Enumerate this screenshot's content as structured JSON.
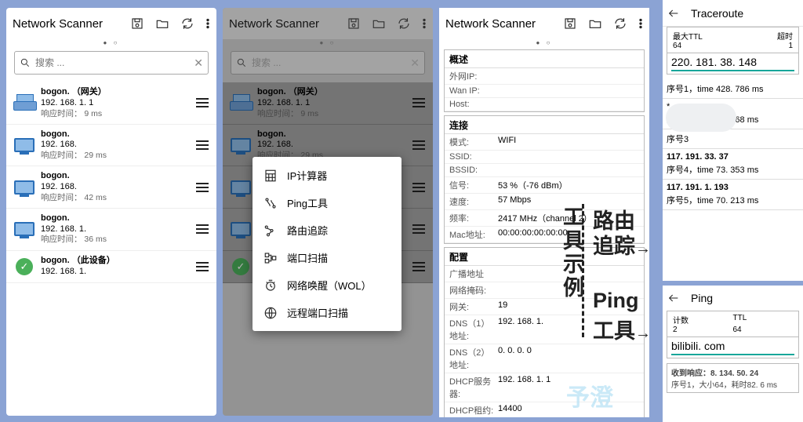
{
  "app_title": "Network Scanner",
  "page_dots": "●  ○",
  "search": {
    "placeholder": "搜索 ..."
  },
  "devices": [
    {
      "name": "bogon. （网关）",
      "ip": "192. 168. 1. 1",
      "rt": "响应时间： 9 ms",
      "icon": "scanner"
    },
    {
      "name": "bogon.",
      "ip": "192. 168.",
      "rt": "响应时间： 29 ms",
      "icon": "monitor"
    },
    {
      "name": "bogon.",
      "ip": "192. 168.",
      "rt": "响应时间： 42 ms",
      "icon": "monitor"
    },
    {
      "name": "bogon.",
      "ip": "192. 168. 1.",
      "rt": "响应时间： 36 ms",
      "icon": "monitor"
    },
    {
      "name": "bogon. （此设备）",
      "ip": "192. 168. 1.",
      "rt": "",
      "icon": "ok"
    }
  ],
  "popup": [
    {
      "icon": "calc",
      "label": "IP计算器"
    },
    {
      "icon": "ping",
      "label": "Ping工具"
    },
    {
      "icon": "trace",
      "label": "路由追踪"
    },
    {
      "icon": "port",
      "label": "端口扫描"
    },
    {
      "icon": "clock",
      "label": "网络唤醒（WOL）"
    },
    {
      "icon": "globe",
      "label": "远程端口扫描"
    }
  ],
  "details": {
    "sections": {
      "overview": {
        "title": "概述",
        "rows": [
          {
            "k": "外网IP:",
            "v": ""
          },
          {
            "k": "Wan IP:",
            "v": ""
          },
          {
            "k": "Host:",
            "v": ""
          }
        ]
      },
      "conn": {
        "title": "连接",
        "rows": [
          {
            "k": "模式:",
            "v": "WIFI"
          },
          {
            "k": "SSID:",
            "v": ""
          },
          {
            "k": "BSSID:",
            "v": ""
          },
          {
            "k": "信号:",
            "v": "53 %（-76 dBm）"
          },
          {
            "k": "速度:",
            "v": "57 Mbps"
          },
          {
            "k": "频率:",
            "v": "2417 MHz（channel 2）"
          },
          {
            "k": "Mac地址:",
            "v": "00:00:00:00:00:00"
          }
        ]
      },
      "config": {
        "title": "配置",
        "rows": [
          {
            "k": "广播地址",
            "v": ""
          },
          {
            "k": "网络掩码:",
            "v": ""
          },
          {
            "k": "网关:",
            "v": "19"
          },
          {
            "k": "DNS（1）地址:",
            "v": "192. 168. 1."
          },
          {
            "k": "DNS（2）地址:",
            "v": "0. 0. 0. 0"
          },
          {
            "k": "DHCP服务器:",
            "v": "192. 168. 1. 1"
          },
          {
            "k": "DHCP租约:",
            "v": "14400"
          }
        ]
      }
    }
  },
  "annot": {
    "col1": "工具示例",
    "label1": "路由",
    "label1b": "追踪",
    "label2": "Ping",
    "label2b": "工具",
    "arrow": "→"
  },
  "watermark": "予澄",
  "traceroute": {
    "title": "Traceroute",
    "maxttl_label": "最大TTL",
    "maxttl": "64",
    "timeout_label": "超时",
    "timeout": "1",
    "host": "220. 181. 38. 148",
    "hops": [
      {
        "seq": "序号1，time 428. 786 ms",
        "ip": ""
      },
      {
        "seq": "序号2，time 42. 368 ms",
        "star": "*",
        "ip": ""
      },
      {
        "seq": "序号3",
        "ip": ""
      },
      {
        "ip": "117. 191. 33. 37",
        "seq": "序号4，time 73. 353 ms"
      },
      {
        "ip": "117. 191. 1. 193",
        "seq": "序号5，time 70. 213 ms"
      }
    ]
  },
  "ping": {
    "title": "Ping",
    "count_label": "计数",
    "count": "2",
    "ttl_label": "TTL",
    "ttl": "64",
    "host": "bilibili. com",
    "reply_label": "收到响应：8. 134. 50. 24",
    "reply_detail": "序号1，大小64，耗时82. 6 ms"
  }
}
